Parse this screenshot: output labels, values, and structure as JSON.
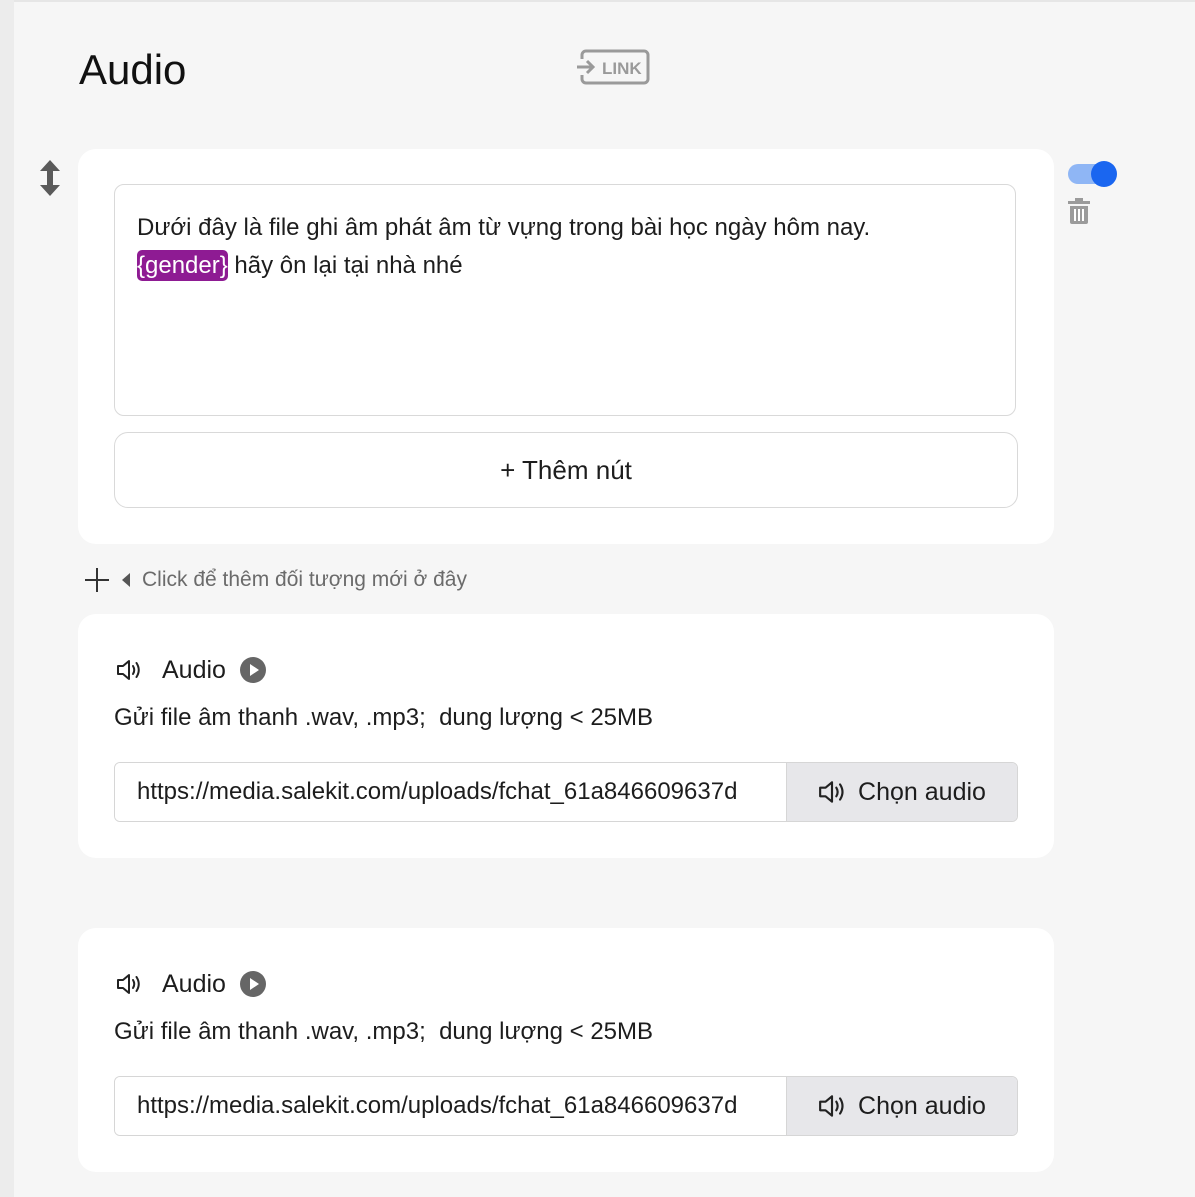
{
  "page": {
    "title": "Audio",
    "link_badge": "LINK"
  },
  "text_block": {
    "content_before": "Dưới đây là file ghi âm phát âm từ vựng trong bài học ngày hôm nay.",
    "variable": "{gender}",
    "content_after": " hãy ôn lại tại nhà nhé",
    "add_button_label": "+ Thêm nút",
    "enabled": true
  },
  "add_object": {
    "hint": "Click để thêm đối tượng mới ở đây"
  },
  "audio_blocks": [
    {
      "title": "Audio",
      "hint": "Gửi file âm thanh .wav, .mp3;  dung lượng < 25MB",
      "url": "https://media.salekit.com/uploads/fchat_61a846609637d",
      "choose_label": "Chọn audio"
    },
    {
      "title": "Audio",
      "hint": "Gửi file âm thanh .wav, .mp3;  dung lượng < 25MB",
      "url": "https://media.salekit.com/uploads/fchat_61a846609637d",
      "choose_label": "Chọn audio"
    }
  ],
  "icons": {
    "drag": "vertical-arrows-icon",
    "trash": "trash-icon",
    "speaker": "speaker-icon",
    "play": "play-circle-icon",
    "plus": "plus-icon",
    "caret": "caret-left-icon"
  },
  "colors": {
    "variable_chip": "#8e1b93",
    "toggle_on": "#1a66f0",
    "toggle_track": "#8fb6f5"
  }
}
